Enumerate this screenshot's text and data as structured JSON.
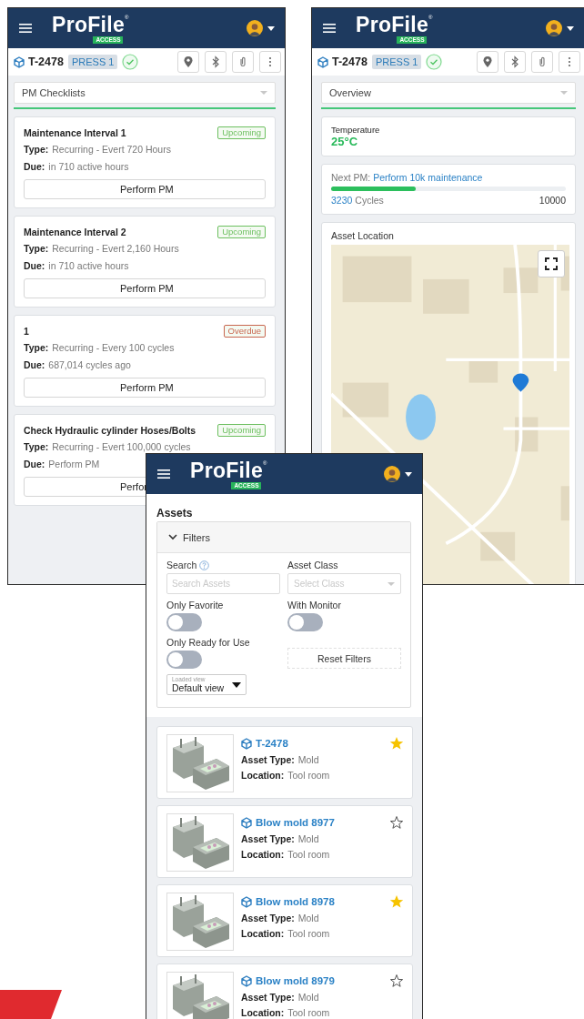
{
  "screens": [
    {
      "kind": "checklists",
      "header": {
        "logo": "ProFile",
        "logo_mark": "®",
        "logo_badge": "ACCESS"
      },
      "asset_bar": {
        "asset_id": "T-2478",
        "tag": "PRESS 1"
      },
      "view_select": "PM Checklists",
      "checklists": [
        {
          "title": "Maintenance Interval 1",
          "status": "Upcoming",
          "color": "#6cbf5f",
          "type_label": "Type:",
          "type": "Recurring - Evert 720 Hours",
          "due_label": "Due:",
          "due": "in 710 active hours",
          "button": "Perform PM"
        },
        {
          "title": "Maintenance Interval 2",
          "status": "Upcoming",
          "color": "#6cbf5f",
          "type_label": "Type:",
          "type": "Recurring - Evert 2,160 Hours",
          "due_label": "Due:",
          "due": "in 710 active hours",
          "button": "Perform PM"
        },
        {
          "title": "1",
          "status": "Overdue",
          "color": "#c8664f",
          "type_label": "Type:",
          "type": "Recurring - Every 100 cycles",
          "due_label": "Due:",
          "due": "687,014 cycles ago",
          "button": "Perform PM"
        },
        {
          "title": "Check Hydraulic cylinder Hoses/Bolts",
          "status": "Upcoming",
          "color": "#6cbf5f",
          "type_label": "Type:",
          "type": "Recurring - Evert 100,000 cycles",
          "due_label": "Due:",
          "due": "Perform PM",
          "button": "Perfor"
        }
      ]
    },
    {
      "kind": "overview",
      "header": {
        "logo": "ProFile",
        "logo_mark": "®",
        "logo_badge": "ACCESS"
      },
      "asset_bar": {
        "asset_id": "T-2478",
        "tag": "PRESS 1"
      },
      "view_select": "Overview",
      "temperature": {
        "label": "Temperature",
        "value": "25°C"
      },
      "next_pm": {
        "label": "Next PM:",
        "task": "Perform 10k maintenance",
        "level": 0.36,
        "count": "3230",
        "unit": "Cycles",
        "target": "10000"
      },
      "location": {
        "title": "Asset Location"
      }
    },
    {
      "kind": "assets",
      "header": {
        "logo": "ProFile",
        "logo_mark": "®",
        "logo_badge": "ACCESS"
      },
      "title": "Assets",
      "filters": {
        "title": "Filters",
        "expanded": true,
        "search": {
          "label": "Search",
          "placeholder": "Search Assets"
        },
        "asset_class": {
          "label": "Asset Class",
          "placeholder": "Select Class"
        },
        "toggles": [
          {
            "label": "Only Favorite",
            "on": false
          },
          {
            "label": "With Monitor",
            "on": false
          },
          {
            "label": "Only Ready for Use",
            "on": false
          }
        ],
        "reset": "Reset Filters",
        "view": {
          "label": "Loaded view",
          "value": "Default view"
        }
      },
      "assets": [
        {
          "name": "T-2478",
          "favorite": true,
          "type_label": "Asset Type:",
          "type": "Mold",
          "location_label": "Location:",
          "location": "Tool room"
        },
        {
          "name": "Blow mold 8977",
          "favorite": false,
          "type_label": "Asset Type:",
          "type": "Mold",
          "location_label": "Location:",
          "location": "Tool room"
        },
        {
          "name": "Blow mold 8978",
          "favorite": true,
          "type_label": "Asset Type:",
          "type": "Mold",
          "location_label": "Location:",
          "location": "Tool room"
        },
        {
          "name": "Blow mold 8979",
          "favorite": false,
          "type_label": "Asset Type:",
          "type": "Mold",
          "location_label": "Location:",
          "location": "Tool room"
        }
      ]
    }
  ]
}
